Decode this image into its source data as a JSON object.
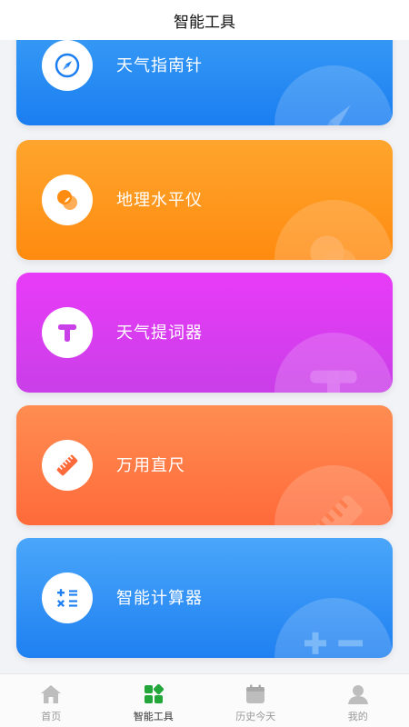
{
  "header": {
    "title": "智能工具"
  },
  "tools": [
    {
      "label": "天气指南针",
      "icon": "compass-icon",
      "color": "#1a7ef1"
    },
    {
      "label": "地理水平仪",
      "icon": "level-icon",
      "color": "#ff8b10"
    },
    {
      "label": "天气提词器",
      "icon": "teleprompter-icon",
      "color": "#c93fe8"
    },
    {
      "label": "万用直尺",
      "icon": "ruler-icon",
      "color": "#ff6a3a"
    },
    {
      "label": "智能计算器",
      "icon": "calculator-icon",
      "color": "#1f80f1"
    }
  ],
  "tabbar": {
    "items": [
      {
        "label": "首页",
        "icon": "home-icon",
        "active": false
      },
      {
        "label": "智能工具",
        "icon": "tools-icon",
        "active": true
      },
      {
        "label": "历史今天",
        "icon": "calendar-icon",
        "active": false
      },
      {
        "label": "我的",
        "icon": "user-icon",
        "active": false
      }
    ],
    "active_color": "#23a63a",
    "inactive_color": "#bdbdbd"
  }
}
